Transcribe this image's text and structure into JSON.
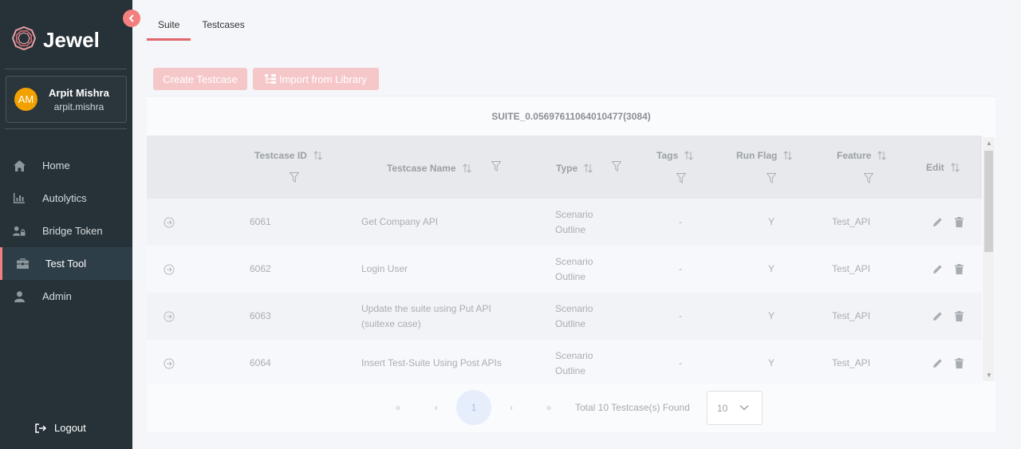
{
  "brand": {
    "name": "Jewel"
  },
  "user": {
    "initials": "AM",
    "name": "Arpit Mishra",
    "handle": "arpit.mishra"
  },
  "nav": [
    {
      "label": "Home",
      "icon": "home-icon",
      "active": false
    },
    {
      "label": "Autolytics",
      "icon": "bar-chart-icon",
      "active": false
    },
    {
      "label": "Bridge Token",
      "icon": "users-lock-icon",
      "active": false
    },
    {
      "label": "Test Tool",
      "icon": "toolbox-icon",
      "active": true
    },
    {
      "label": "Admin",
      "icon": "user-icon",
      "active": false
    }
  ],
  "logout_label": "Logout",
  "tabs": [
    {
      "label": "Suite",
      "active": true
    },
    {
      "label": "Testcases",
      "active": false
    }
  ],
  "toolbar": {
    "create_label": "Create Testcase",
    "import_label": "Import from Library"
  },
  "suite_title": "SUITE_0.05697611064010477(3084)",
  "table": {
    "columns": [
      "Testcase ID",
      "Testcase Name",
      "Type",
      "Tags",
      "Run Flag",
      "Feature",
      "Edit"
    ],
    "rows": [
      {
        "id": "6061",
        "name": "Get Company API",
        "type": "Scenario Outline",
        "tags": "-",
        "run_flag": "Y",
        "feature": "Test_API"
      },
      {
        "id": "6062",
        "name": "Login User",
        "type": "Scenario Outline",
        "tags": "-",
        "run_flag": "Y",
        "feature": "Test_API"
      },
      {
        "id": "6063",
        "name": "Update the suite using Put API (suitexe case)",
        "type": "Scenario Outline",
        "tags": "-",
        "run_flag": "Y",
        "feature": "Test_API"
      },
      {
        "id": "6064",
        "name": "Insert Test-Suite Using Post APIs",
        "type": "Scenario Outline",
        "tags": "-",
        "run_flag": "Y",
        "feature": "Test_API"
      }
    ]
  },
  "pagination": {
    "first": "«",
    "prev": "‹",
    "current": "1",
    "next": "›",
    "last": "»",
    "total_text": "Total 10 Testcase(s) Found",
    "page_size": "10"
  },
  "colors": {
    "sidebar_bg": "#263238",
    "accent": "#e0676b",
    "button_disabled": "#f6c7c9"
  }
}
